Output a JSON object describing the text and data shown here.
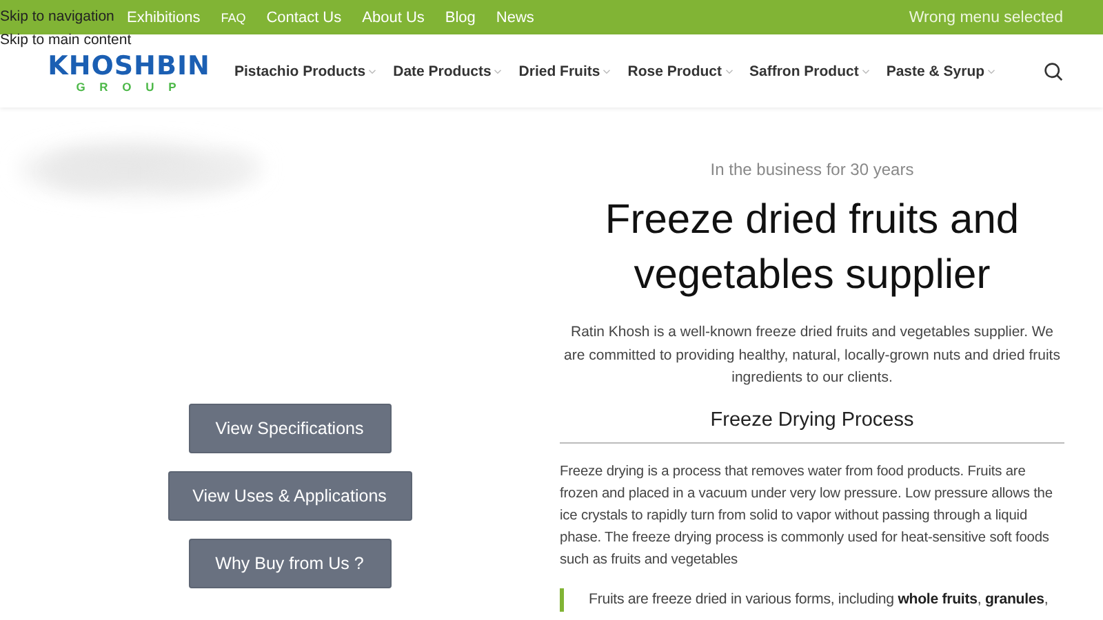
{
  "skip_links": [
    "Skip to navigation",
    "Skip to main content"
  ],
  "top_bar": {
    "links": [
      "Exhibitions",
      "FAQ",
      "Contact Us",
      "About Us",
      "Blog",
      "News"
    ],
    "notice": "Wrong menu selected"
  },
  "header": {
    "logo": {
      "name": "KHOSHBIN",
      "tagline": "G R O U P"
    },
    "menu": [
      {
        "label": "Pistachio Products"
      },
      {
        "label": "Date Products"
      },
      {
        "label": "Dried Fruits"
      },
      {
        "label": "Rose Product"
      },
      {
        "label": "Saffron Product"
      },
      {
        "label": "Paste & Syrup"
      }
    ]
  },
  "hero": {
    "kind": "picture"
  },
  "buttons": [
    "View Specifications",
    "View Uses & Applications",
    "Why Buy from Us ?"
  ],
  "intro": {
    "eyebrow": "In the business for 30 years",
    "title": "Freeze dried fruits and vegetables supplier",
    "text": "Ratin Khosh is a well-known freeze dried fruits and vegetables supplier. We are committed to providing healthy, natural, locally-grown nuts and dried fruits ingredients to our clients."
  },
  "section": {
    "heading": "Freeze Drying Process",
    "text": "Freeze drying is a process that removes water from food products. Fruits are frozen and placed in a vacuum under very low pressure. Low pressure allows the ice crystals to rapidly turn from solid to vapor without passing through a liquid phase. The freeze drying process is commonly used for heat-sensitive soft foods such as fruits and vegetables",
    "quote": "Fruits are freeze dried in various forms, including **whole fruits**, **granules**,"
  }
}
